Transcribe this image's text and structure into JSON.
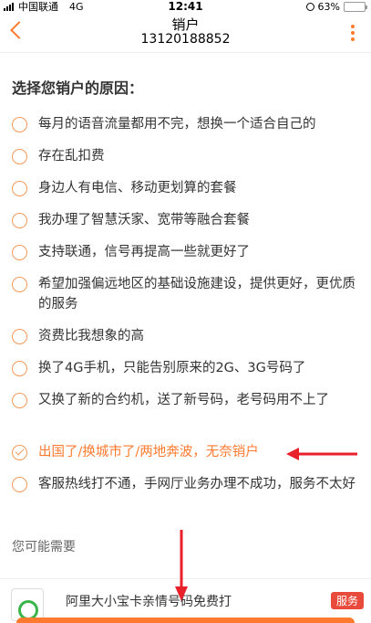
{
  "status": {
    "carrier": "中国联通",
    "network": "4G",
    "time": "12:41",
    "battery": "63%",
    "battery_level": 0.63
  },
  "nav": {
    "title": "销户",
    "phone": "13120188852"
  },
  "heading": "选择您销户的原因：",
  "options": [
    {
      "text": "每月的语音流量都用不完，想换一个适合自己的",
      "checked": false
    },
    {
      "text": "存在乱扣费",
      "checked": false
    },
    {
      "text": "身边人有电信、移动更划算的套餐",
      "checked": false
    },
    {
      "text": "我办理了智慧沃家、宽带等融合套餐",
      "checked": false
    },
    {
      "text": "支持联通，信号再提高一些就更好了",
      "checked": false
    },
    {
      "text": "希望加强偏远地区的基础设施建设，提供更好，更优质的服务",
      "checked": false
    },
    {
      "text": "资费比我想象的高",
      "checked": false
    },
    {
      "text": "换了4G手机，只能告别原来的2G、3G号码了",
      "checked": false
    },
    {
      "text": "又换了新的合约机，送了新号码，老号码用不上了",
      "checked": false
    },
    {
      "text": "出国了/换城市了/两地奔波，无奈销户",
      "checked": true
    },
    {
      "text": "客服热线打不通，手网厅业务办理不成功，服务不太好",
      "checked": false
    }
  ],
  "you_may_need": "您可能需要",
  "card": {
    "title": "阿里大小宝卡亲情号码免费打",
    "tag": "服务"
  },
  "colors": {
    "accent": "#ff7a2f",
    "radio": "#f39a5a",
    "tag": "#e84a3c",
    "annotation": "#e8202a"
  }
}
